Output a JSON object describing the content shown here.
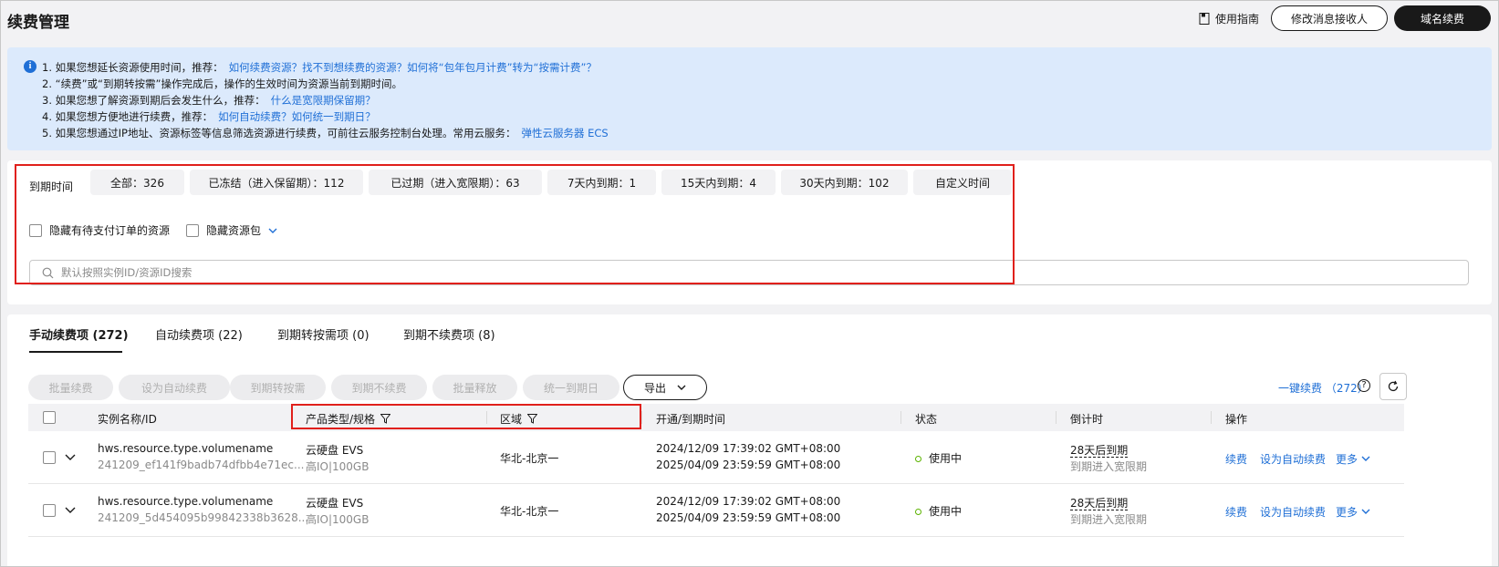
{
  "header": {
    "title": "续费管理",
    "guide_label": "使用指南",
    "modify_receiver_label": "修改消息接收人",
    "domain_renew_label": "域名续费"
  },
  "notice": {
    "lines": [
      {
        "text": "1. 如果您想延长资源使用时间，推荐：",
        "link": "如何续费资源？找不到想续费的资源？如何将“包年包月计费”转为“按需计费”？"
      },
      {
        "text": "2. “续费”或“到期转按需”操作完成后，操作的生效时间为资源当前到期时间。",
        "link": ""
      },
      {
        "text": "3. 如果您想了解资源到期后会发生什么，推荐：",
        "link": "什么是宽限期保留期？"
      },
      {
        "text": "4. 如果您想方便地进行续费，推荐：",
        "link": "如何自动续费？如何统一到期日？"
      },
      {
        "text": "5. 如果您想通过IP地址、资源标签等信息筛选资源进行续费，可前往云服务控制台处理。常用云服务：",
        "link": "弹性云服务器 ECS"
      }
    ]
  },
  "filter": {
    "label": "到期时间",
    "chips": [
      "全部：326",
      "已冻结（进入保留期）：112",
      "已过期（进入宽限期）：63",
      "7天内到期：1",
      "15天内到期：4",
      "30天内到期：102",
      "自定义时间"
    ],
    "hide_pending_label": "隐藏有待支付订单的资源",
    "hide_package_label": "隐藏资源包",
    "search_placeholder": "默认按照实例ID/资源ID搜索"
  },
  "tabs": [
    "手动续费项 (272)",
    "自动续费项 (22)",
    "到期转按需项 (0)",
    "到期不续费项 (8)"
  ],
  "actions": {
    "buttons": [
      "批量续费",
      "设为自动续费",
      "到期转按需",
      "到期不续费",
      "批量释放",
      "统一到期日"
    ],
    "export_label": "导出",
    "one_click_renew": "一键续费 （272）"
  },
  "table": {
    "columns": [
      "实例名称/ID",
      "产品类型/规格",
      "区域",
      "开通/到期时间",
      "状态",
      "倒计时",
      "操作"
    ],
    "rows": [
      {
        "name": "hws.resource.type.volumename",
        "id": "241209_ef141f9badb74dfbb4e71ec...",
        "product": "云硬盘 EVS",
        "spec": "高IO|100GB",
        "region": "华北-北京一",
        "open_time": "2024/12/09 17:39:02 GMT+08:00",
        "expire_time": "2025/04/09 23:59:59 GMT+08:00",
        "status": "使用中",
        "countdown": "28天后到期",
        "countdown_note": "到期进入宽限期",
        "ops": [
          "续费",
          "设为自动续费",
          "更多"
        ]
      },
      {
        "name": "hws.resource.type.volumename",
        "id": "241209_5d454095b99842338b3628...",
        "product": "云硬盘 EVS",
        "spec": "高IO|100GB",
        "region": "华北-北京一",
        "open_time": "2024/12/09 17:39:02 GMT+08:00",
        "expire_time": "2025/04/09 23:59:59 GMT+08:00",
        "status": "使用中",
        "countdown": "28天后到期",
        "countdown_note": "到期进入宽限期",
        "ops": [
          "续费",
          "设为自动续费",
          "更多"
        ]
      }
    ]
  },
  "colors": {
    "accent": "#1f6fd6",
    "highlight_border": "#e0201b",
    "status_ok": "#5cb300",
    "notice_bg": "#dceafc"
  }
}
